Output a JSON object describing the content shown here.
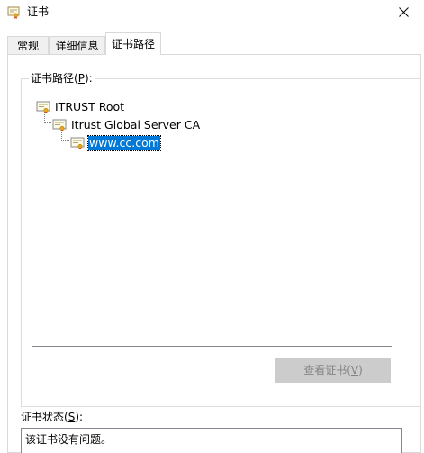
{
  "window": {
    "title": "证书",
    "icon": "certificate-icon",
    "close_icon": "close-icon"
  },
  "tabs": [
    {
      "label": "常规",
      "active": false
    },
    {
      "label": "详细信息",
      "active": false
    },
    {
      "label": "证书路径",
      "active": true
    }
  ],
  "cert_path": {
    "group_label_prefix": "证书路径(",
    "group_label_key": "P",
    "group_label_suffix": "):",
    "nodes": [
      {
        "label": "ITRUST Root",
        "icon": "certificate-icon",
        "selected": false
      },
      {
        "label": "Itrust Global Server CA",
        "icon": "certificate-icon",
        "selected": false
      },
      {
        "label": "www.cc.com",
        "icon": "certificate-icon",
        "selected": true
      }
    ],
    "view_button_prefix": "查看证书(",
    "view_button_key": "V",
    "view_button_suffix": ")",
    "view_button_enabled": false
  },
  "status": {
    "label_prefix": "证书状态(",
    "label_key": "S",
    "label_suffix": "):",
    "text": "该证书没有问题。"
  },
  "colors": {
    "selection": "#0078d7",
    "disabled_button_bg": "#cccccc",
    "disabled_button_text": "#838383"
  }
}
